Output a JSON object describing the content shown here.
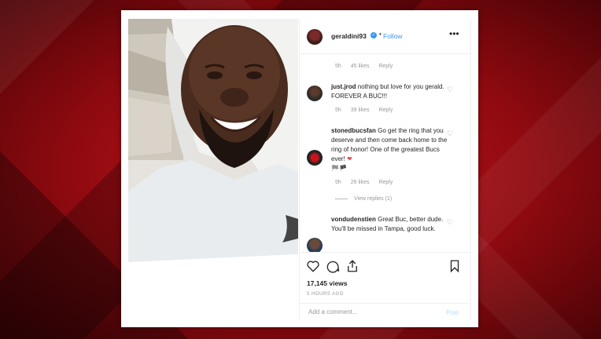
{
  "header": {
    "username": "geraldini93",
    "follow_label": "Follow",
    "dot": "•",
    "more": "•••",
    "verified_mark": "✓"
  },
  "comments": [
    {
      "username": "",
      "text": "",
      "time": "5h",
      "likes": "45 likes",
      "reply": "Reply"
    },
    {
      "username": "just.jrod",
      "text": "nothing but love for you gerald. FOREVER A BUC!!!",
      "time": "5h",
      "likes": "39 likes",
      "reply": "Reply"
    },
    {
      "username": "stonedbucsfan",
      "text": "Go get the ring that you deserve and then come back home to the ring of honor! One of the greatest Bucs ever!",
      "emoji": "❤",
      "flags": "🏁🏴",
      "time": "5h",
      "likes": "26 likes",
      "reply": "Reply",
      "view_replies": "View replies (1)"
    },
    {
      "username": "vondudenstien",
      "text": "Great Buc, better dude. You'll be missed in Tampa, good luck.",
      "time": "",
      "likes": "",
      "reply": ""
    }
  ],
  "actions": {
    "views": "17,145 views",
    "time_ago": "5 HOURS AGO",
    "add_comment_placeholder": "Add a comment...",
    "post_label": "Post"
  },
  "colors": {
    "accent": "#3897f0",
    "background_red": "#c8151b",
    "heart_red": "#ed4956"
  }
}
